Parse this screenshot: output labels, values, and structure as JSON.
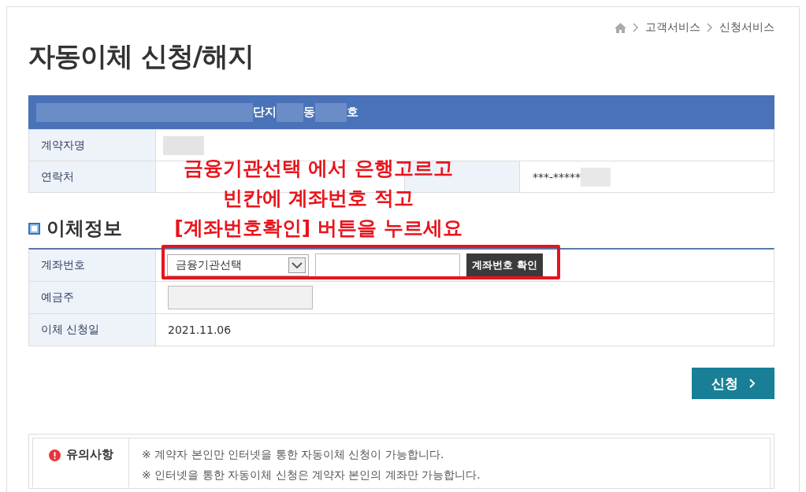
{
  "breadcrumb": [
    "고객서비스",
    "신청서비스"
  ],
  "title": "자동이체 신청/해지",
  "unit_header": {
    "parts": [
      "단지",
      "동",
      "호"
    ]
  },
  "contract": {
    "name_label": "계약자명",
    "contact_label": "연락처",
    "phone_value": "***-*****"
  },
  "transfer": {
    "heading": "이체정보",
    "rows": [
      {
        "kind": "account",
        "label": "계좌번호",
        "bank_select": "금융기관선택",
        "confirm_button": "계좌번호 확인"
      },
      {
        "kind": "holder",
        "label": "예금주"
      },
      {
        "kind": "date",
        "label": "이체 신청일",
        "value": "2021.11.06"
      }
    ]
  },
  "submit_button": "신청",
  "notice": {
    "heading": "유의사항",
    "items": [
      "※ 계약자 본인만 인터넷을 통한 자동이체 신청이 가능합니다.",
      "※ 인터넷을 통한 자동이체 신청은 계약자 본인의 계좌만 가능합니다."
    ]
  },
  "annotation": {
    "lines": [
      "금융기관선택 에서 은행고르고",
      "빈칸에 계좌번호 적고",
      "[계좌번호확인] 버튼을 누르세요"
    ]
  }
}
